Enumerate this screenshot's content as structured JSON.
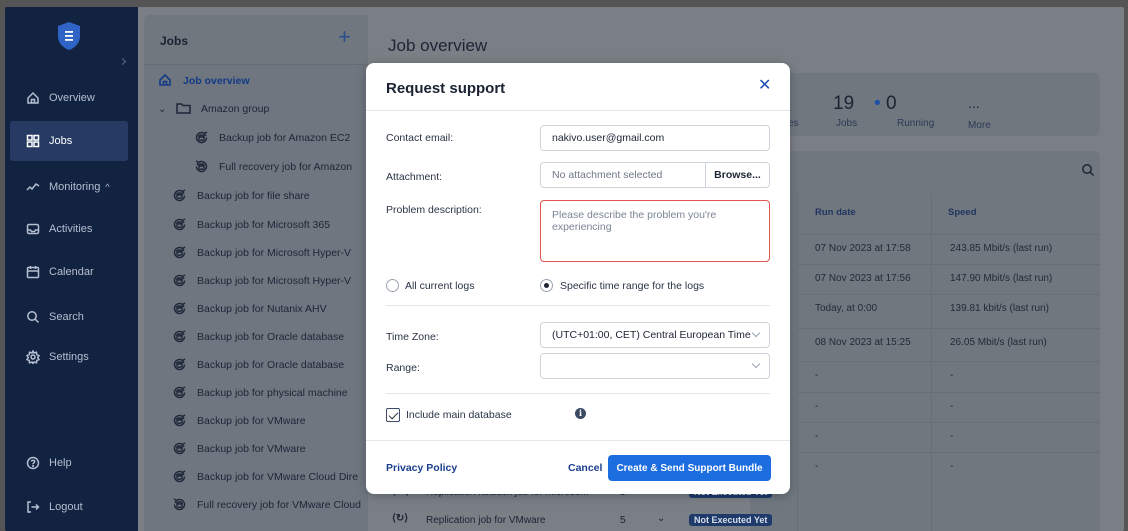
{
  "sidebar": {
    "items": [
      {
        "label": "Overview",
        "icon": "home-icon"
      },
      {
        "label": "Jobs",
        "icon": "grid-icon"
      },
      {
        "label": "Monitoring",
        "icon": "pulse-icon"
      },
      {
        "label": "Activities",
        "icon": "inbox-icon"
      },
      {
        "label": "Calendar",
        "icon": "calendar-icon"
      },
      {
        "label": "Search",
        "icon": "search-icon"
      },
      {
        "label": "Settings",
        "icon": "gear-icon"
      }
    ],
    "help": "Help",
    "logout": "Logout"
  },
  "jobs_panel": {
    "title": "Jobs",
    "add": "+",
    "items": [
      {
        "label": "Job overview"
      },
      {
        "label": "Amazon group"
      },
      {
        "label": "Backup job for Amazon EC2"
      },
      {
        "label": "Full recovery job for Amazon"
      },
      {
        "label": "Backup job for file share"
      },
      {
        "label": "Backup job for Microsoft 365"
      },
      {
        "label": "Backup job for Microsoft Hyper-V"
      },
      {
        "label": "Backup job for Microsoft Hyper-V"
      },
      {
        "label": "Backup job for Nutanix AHV"
      },
      {
        "label": "Backup job for Oracle database"
      },
      {
        "label": "Backup job for Oracle database"
      },
      {
        "label": "Backup job for physical machine"
      },
      {
        "label": "Backup job for VMware"
      },
      {
        "label": "Backup job for VMware"
      },
      {
        "label": "Backup job for VMware Cloud Dire"
      },
      {
        "label": "Full recovery job for VMware Cloud"
      }
    ]
  },
  "main": {
    "title": "Job overview",
    "stats": {
      "partial_label": "es",
      "jobs_value": "19",
      "jobs_label": "Jobs",
      "running_value": "0",
      "running_label": "Running",
      "more_value": "...",
      "more_label": "More"
    },
    "table": {
      "headers": {
        "run_date": "Run date",
        "speed": "Speed"
      },
      "rows": [
        {
          "run_date": "07 Nov 2023 at 17:58",
          "speed": "243.85 Mbit/s (last run)"
        },
        {
          "run_date": "07 Nov 2023 at 17:56",
          "speed": "147.90 Mbit/s (last run)"
        },
        {
          "run_date": "Today, at 0:00",
          "speed": "139.81 kbit/s (last run)"
        },
        {
          "run_date": "08 Nov 2023 at 15:25",
          "speed": "26.05 Mbit/s (last run)"
        },
        {
          "run_date": "-",
          "speed": "-"
        },
        {
          "run_date": "-",
          "speed": "-"
        },
        {
          "run_date": "-",
          "speed": "-"
        },
        {
          "run_date": "-",
          "speed": "-"
        },
        {
          "run_date": "-",
          "speed": "-"
        },
        {
          "run_date": "-",
          "speed": "-"
        }
      ]
    },
    "bottom_rows": [
      {
        "name": "Replication failback job for Microso...",
        "count": "5",
        "status": "Not Executed Yet"
      },
      {
        "name": "Replication job for VMware",
        "count": "5",
        "status": "Not Executed Yet"
      }
    ]
  },
  "modal": {
    "title": "Request support",
    "close": "✕",
    "contact_email_label": "Contact email:",
    "contact_email_value": "nakivo.user@gmail.com",
    "attachment_label": "Attachment:",
    "attachment_value": "No attachment selected",
    "browse": "Browse...",
    "problem_label": "Problem description:",
    "problem_placeholder": "Please describe the problem you're experiencing",
    "radio_all_logs": "All current logs",
    "radio_time_range": "Specific time range for the logs",
    "timezone_label": "Time Zone:",
    "timezone_value": "(UTC+01:00, CET) Central European Time",
    "range_label": "Range:",
    "range_value": "",
    "include_db": "Include main database",
    "info": "i",
    "privacy": "Privacy Policy",
    "cancel": "Cancel",
    "submit": "Create & Send Support Bundle"
  },
  "colors": {
    "sidebar_bg": "#122241",
    "primary": "#1c6ee0",
    "error_border": "#e2584f",
    "badge_bg": "#1e3a6a"
  }
}
